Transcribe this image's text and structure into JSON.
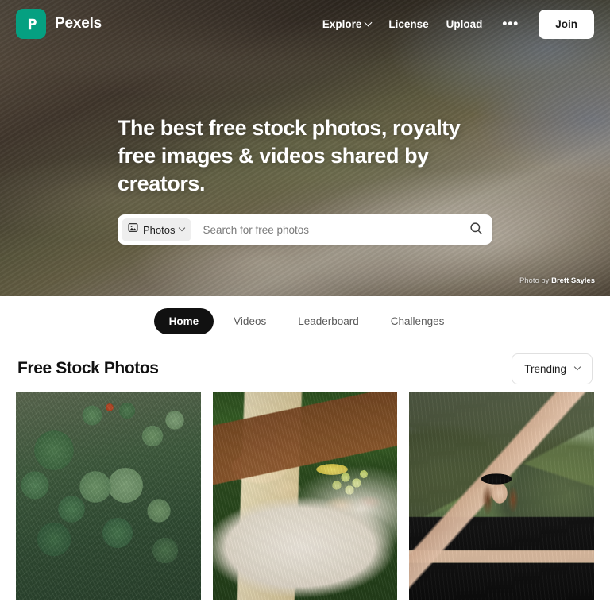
{
  "header": {
    "brand": "Pexels",
    "logo_icon": "pexels-p-logo-icon",
    "logo_color": "#05a081",
    "nav": [
      {
        "label": "Explore",
        "has_caret": true
      },
      {
        "label": "License",
        "has_caret": false
      },
      {
        "label": "Upload",
        "has_caret": false
      }
    ],
    "more_label": "•••",
    "more_icon": "ellipsis-icon",
    "join_label": "Join"
  },
  "hero": {
    "title": "The best free stock photos, royalty free images & videos shared by creators.",
    "search": {
      "type_label": "Photos",
      "type_icon": "image-icon",
      "caret_icon": "chevron-down-icon",
      "placeholder": "Search for free photos",
      "value": "",
      "submit_icon": "search-icon"
    },
    "credit_prefix": "Photo by ",
    "credit_author": "Brett Sayles",
    "background_alt": "aerial-coastline-photo"
  },
  "tabs": {
    "items": [
      {
        "label": "Home",
        "active": true
      },
      {
        "label": "Videos",
        "active": false
      },
      {
        "label": "Leaderboard",
        "active": false
      },
      {
        "label": "Challenges",
        "active": false
      }
    ]
  },
  "section": {
    "title": "Free Stock Photos",
    "sort_label": "Trending",
    "sort_caret_icon": "chevron-down-icon"
  },
  "gallery": {
    "photos": [
      {
        "alt": "prickly-pear-cactus-cluster"
      },
      {
        "alt": "picnic-charcuterie-board-on-grass"
      },
      {
        "alt": "woman-in-black-hat-green-mountains"
      }
    ]
  },
  "colors": {
    "brand_green": "#05a081",
    "active_tab_bg": "#111111",
    "page_bg": "#ffffff"
  }
}
